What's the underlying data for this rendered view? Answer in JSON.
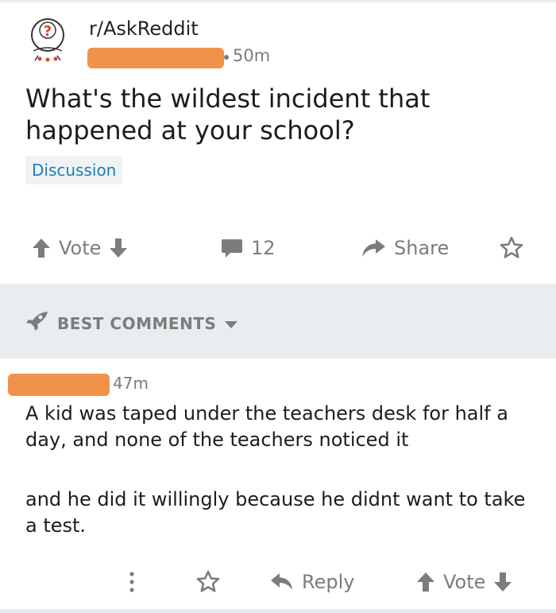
{
  "post": {
    "subreddit": "r/AskReddit",
    "time": "50m",
    "title": "What's the wildest incident that happened at your school?",
    "flair": "Discussion"
  },
  "actions": {
    "vote_label": "Vote",
    "comment_count": "12",
    "share_label": "Share"
  },
  "sort": {
    "label": "BEST COMMENTS"
  },
  "comment": {
    "time": "47m",
    "paragraphs": [
      "A kid was taped under the teachers desk for half a day, and none of the teachers noticed it",
      "and he did it willingly because he didnt want to take a test."
    ],
    "reply_label": "Reply",
    "vote_label": "Vote"
  },
  "colors": {
    "accent_link": "#1e7db8",
    "muted": "#7c7c7c",
    "redaction": "#f0924a",
    "sort_bar_bg": "#e9edef"
  },
  "icons": [
    "subreddit-avatar-icon",
    "upvote-icon",
    "downvote-icon",
    "comment-icon",
    "share-icon",
    "star-icon",
    "rocket-icon",
    "caret-down-icon",
    "more-vertical-icon",
    "reply-icon"
  ]
}
